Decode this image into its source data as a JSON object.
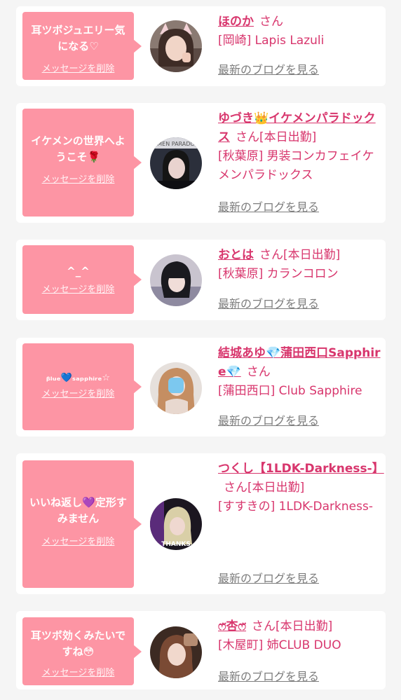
{
  "common": {
    "delete_label": "メッセージを削除",
    "san": "さん",
    "blog_label": "最新のブログを見る"
  },
  "colors": {
    "bubble": "#fd95a4",
    "accent": "#d8366d",
    "link_gray": "#7d7d7d",
    "background": "#f5f5f5"
  },
  "cards": [
    {
      "message": "耳ツボジュエリー気になる♡",
      "name": "ほのか",
      "attendance": "",
      "area": "[岡崎] Lapis Lazuli"
    },
    {
      "message": "イケメンの世界へようこそ🌹",
      "name": "ゆづき👑イケメンパラドックス",
      "attendance": "[本日出勤]",
      "area": "[秋葉原] 男装コンカフェイケメンパラドックス",
      "avatar_text": "MEN PARADO"
    },
    {
      "message": "^_^",
      "name": "おとは",
      "attendance": "[本日出勤]",
      "area": "[秋葉原] カランコロン"
    },
    {
      "message": "ᵦₗᵤₑ💙ₛₐₚₚₕᵢᵣₑ☆",
      "name": "結城あゆ💎蒲田西口Sapphire💎",
      "attendance": "",
      "area": "[蒲田西口] Club Sapphire"
    },
    {
      "message": "いいね返し💜定形すみません",
      "name": "つくし【1LDK-Darkness-】",
      "attendance": "[本日出勤]",
      "area": "[すすきの] 1LDK-Darkness-",
      "avatar_text": "THANKS"
    },
    {
      "message": "耳ツボ効くみたいですね😳",
      "name": "ෆ̈杏ෆ̈",
      "attendance": "[本日出勤]",
      "area": "[木屋町] 姉CLUB DUO"
    }
  ]
}
